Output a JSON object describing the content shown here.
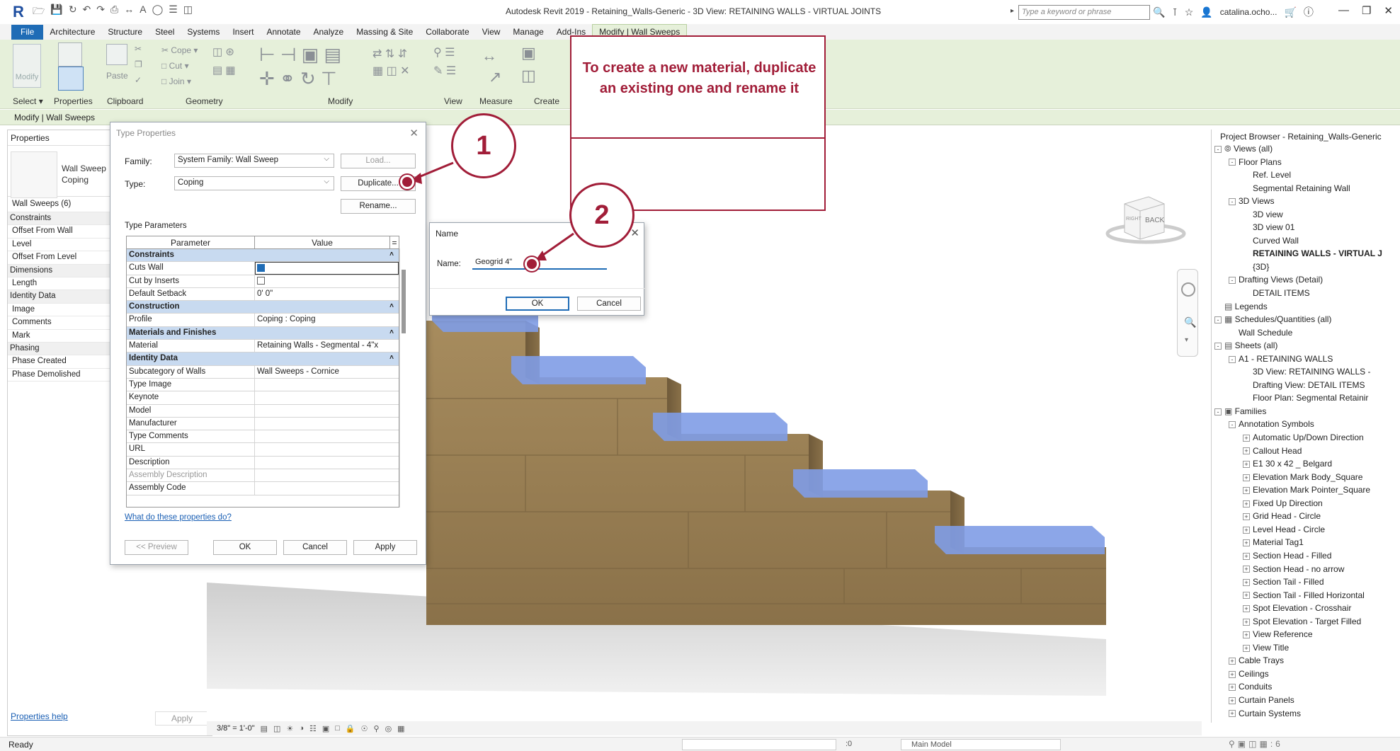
{
  "window": {
    "title": "Autodesk Revit 2019 - Retaining_Walls-Generic - 3D View: RETAINING WALLS - VIRTUAL JOINTS",
    "search_placeholder": "Type a keyword or phrase",
    "user": "catalina.ocho..."
  },
  "ribbon": {
    "tabs": [
      "File",
      "Architecture",
      "Structure",
      "Steel",
      "Systems",
      "Insert",
      "Annotate",
      "Analyze",
      "Massing & Site",
      "Collaborate",
      "View",
      "Manage",
      "Add-Ins",
      "Modify | Wall Sweeps"
    ],
    "groups": {
      "select": "Select",
      "properties": "Properties",
      "clipboard": "Clipboard",
      "geometry": "Geometry",
      "modify": "Modify",
      "view": "View",
      "measure": "Measure",
      "create": "Create"
    },
    "tools": {
      "modify": "Modify",
      "paste": "Paste",
      "cope": "Cope",
      "cut": "Cut",
      "join": "Join"
    }
  },
  "context_bar": "Modify | Wall Sweeps",
  "properties_panel": {
    "header": "Properties",
    "type_name_line1": "Wall Sweep",
    "type_name_line2": "Coping",
    "selector": "Wall Sweeps (6)",
    "rows": [
      {
        "label": "Constraints",
        "cat": true
      },
      {
        "label": "Offset From Wall",
        "cat": false
      },
      {
        "label": "Level",
        "cat": false
      },
      {
        "label": "Offset From Level",
        "cat": false
      },
      {
        "label": "Dimensions",
        "cat": true
      },
      {
        "label": "Length",
        "cat": false
      },
      {
        "label": "Identity Data",
        "cat": true
      },
      {
        "label": "Image",
        "cat": false
      },
      {
        "label": "Comments",
        "cat": false
      },
      {
        "label": "Mark",
        "cat": false
      },
      {
        "label": "Phasing",
        "cat": true
      },
      {
        "label": "Phase Created",
        "cat": false
      },
      {
        "label": "Phase Demolished",
        "cat": false
      }
    ],
    "help_link": "Properties help",
    "apply": "Apply"
  },
  "type_properties": {
    "title": "Type Properties",
    "family_label": "Family:",
    "family_value": "System Family: Wall Sweep",
    "type_label": "Type:",
    "type_value": "Coping",
    "load_button": "Load...",
    "duplicate_button": "Duplicate...",
    "rename_button": "Rename...",
    "section_label": "Type Parameters",
    "col_parameter": "Parameter",
    "col_value": "Value",
    "rows": [
      {
        "p": "Constraints",
        "v": "",
        "cat": true
      },
      {
        "p": "Cuts Wall",
        "v": "",
        "chk": "on"
      },
      {
        "p": "Cut by Inserts",
        "v": "",
        "chk": "off"
      },
      {
        "p": "Default Setback",
        "v": "0'  0\""
      },
      {
        "p": "Construction",
        "v": "",
        "cat": true
      },
      {
        "p": "Profile",
        "v": "Coping : Coping"
      },
      {
        "p": "Materials and Finishes",
        "v": "",
        "cat": true
      },
      {
        "p": "Material",
        "v": "Retaining Walls - Segmental - 4\"x"
      },
      {
        "p": "Identity Data",
        "v": "",
        "cat": true
      },
      {
        "p": "Subcategory of Walls",
        "v": "Wall Sweeps - Cornice"
      },
      {
        "p": "Type Image",
        "v": ""
      },
      {
        "p": "Keynote",
        "v": ""
      },
      {
        "p": "Model",
        "v": ""
      },
      {
        "p": "Manufacturer",
        "v": ""
      },
      {
        "p": "Type Comments",
        "v": ""
      },
      {
        "p": "URL",
        "v": ""
      },
      {
        "p": "Description",
        "v": ""
      },
      {
        "p": "Assembly Description",
        "v": "",
        "dim": true
      },
      {
        "p": "Assembly Code",
        "v": ""
      }
    ],
    "help_link": "What do these properties do?",
    "preview_button": "<< Preview",
    "ok_button": "OK",
    "cancel_button": "Cancel",
    "apply_button": "Apply"
  },
  "name_dialog": {
    "title": "Name",
    "label": "Name:",
    "value": "Geogrid 4\"",
    "ok_button": "OK",
    "cancel_button": "Cancel"
  },
  "annotation": {
    "callout": "To create a new material, duplicate an existing one and rename it",
    "step1": "1",
    "step2": "2"
  },
  "view": {
    "scale": "3/8\" = 1'-0\"",
    "viewcube_face": "BACK",
    "viewcube_side": "RIGHT"
  },
  "project_browser": {
    "header": "Project Browser - Retaining_Walls-Generic",
    "nodes": [
      {
        "t": "Views (all)",
        "d": 0,
        "toggle": "-"
      },
      {
        "t": "Floor Plans",
        "d": 1,
        "toggle": "-"
      },
      {
        "t": "Ref. Level",
        "d": 2
      },
      {
        "t": "Segmental Retaining Wall",
        "d": 2
      },
      {
        "t": "3D Views",
        "d": 1,
        "toggle": "-"
      },
      {
        "t": "3D view",
        "d": 2
      },
      {
        "t": "3D view 01",
        "d": 2
      },
      {
        "t": "Curved Wall",
        "d": 2
      },
      {
        "t": "RETAINING WALLS - VIRTUAL J",
        "d": 2,
        "bold": true
      },
      {
        "t": "{3D}",
        "d": 2
      },
      {
        "t": "Drafting Views (Detail)",
        "d": 1,
        "toggle": "-"
      },
      {
        "t": "DETAIL ITEMS",
        "d": 2
      },
      {
        "t": "Legends",
        "d": 0
      },
      {
        "t": "Schedules/Quantities (all)",
        "d": 0,
        "toggle": "-"
      },
      {
        "t": "Wall Schedule",
        "d": 1
      },
      {
        "t": "Sheets (all)",
        "d": 0,
        "toggle": "-"
      },
      {
        "t": "A1 - RETAINING WALLS",
        "d": 1,
        "toggle": "-"
      },
      {
        "t": "3D View: RETAINING WALLS -",
        "d": 2
      },
      {
        "t": "Drafting View: DETAIL ITEMS",
        "d": 2
      },
      {
        "t": "Floor Plan: Segmental Retainir",
        "d": 2
      },
      {
        "t": "Families",
        "d": 0,
        "toggle": "-"
      },
      {
        "t": "Annotation Symbols",
        "d": 1,
        "toggle": "-"
      },
      {
        "t": "Automatic Up/Down Direction",
        "d": 2,
        "toggle": "+"
      },
      {
        "t": "Callout Head",
        "d": 2,
        "toggle": "+"
      },
      {
        "t": "E1 30 x 42 _ Belgard",
        "d": 2,
        "toggle": "+"
      },
      {
        "t": "Elevation Mark Body_Square",
        "d": 2,
        "toggle": "+"
      },
      {
        "t": "Elevation Mark Pointer_Square",
        "d": 2,
        "toggle": "+"
      },
      {
        "t": "Fixed Up Direction",
        "d": 2,
        "toggle": "+"
      },
      {
        "t": "Grid Head - Circle",
        "d": 2,
        "toggle": "+"
      },
      {
        "t": "Level Head - Circle",
        "d": 2,
        "toggle": "+"
      },
      {
        "t": "Material Tag1",
        "d": 2,
        "toggle": "+"
      },
      {
        "t": "Section Head - Filled",
        "d": 2,
        "toggle": "+"
      },
      {
        "t": "Section Head - no arrow",
        "d": 2,
        "toggle": "+"
      },
      {
        "t": "Section Tail - Filled",
        "d": 2,
        "toggle": "+"
      },
      {
        "t": "Section Tail - Filled Horizontal",
        "d": 2,
        "toggle": "+"
      },
      {
        "t": "Spot Elevation - Crosshair",
        "d": 2,
        "toggle": "+"
      },
      {
        "t": "Spot Elevation - Target Filled",
        "d": 2,
        "toggle": "+"
      },
      {
        "t": "View Reference",
        "d": 2,
        "toggle": "+"
      },
      {
        "t": "View Title",
        "d": 2,
        "toggle": "+"
      },
      {
        "t": "Cable Trays",
        "d": 1,
        "toggle": "+"
      },
      {
        "t": "Ceilings",
        "d": 1,
        "toggle": "+"
      },
      {
        "t": "Conduits",
        "d": 1,
        "toggle": "+"
      },
      {
        "t": "Curtain Panels",
        "d": 1,
        "toggle": "+"
      },
      {
        "t": "Curtain Systems",
        "d": 1,
        "toggle": "+"
      }
    ]
  },
  "status_bar": {
    "ready": "Ready",
    "zero": ":0",
    "model": "Main Model",
    "filter_count": ":6"
  },
  "colors": {
    "accent": "#a11d38",
    "ribbon_bg": "#e6f0da",
    "revit_blue": "#1f6cb6",
    "coping_blue": "#7f9ce6",
    "wall_tan": "#9c8459"
  }
}
